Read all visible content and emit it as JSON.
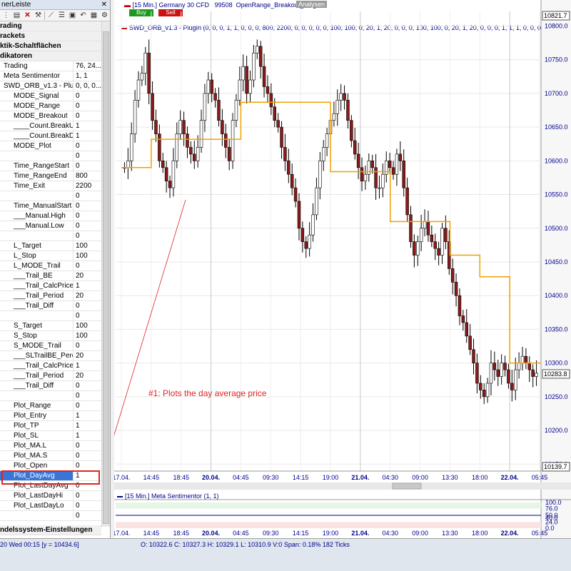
{
  "left_panel": {
    "title": "nerLeiste",
    "close": "✕",
    "toolbar_icons": [
      "grip-icon",
      "save-icon",
      "delete-icon",
      "tools-icon",
      "chart-icon",
      "list-icon",
      "view-icon",
      "undo-icon",
      "table-icon",
      "settings-icon"
    ],
    "categories": [
      "rading",
      "rackets",
      "ktik-Schaltflächen",
      "dikatoren"
    ],
    "properties": [
      {
        "name": "Trading",
        "value": "76, 24...",
        "indent": false
      },
      {
        "name": "Meta Sentimentor",
        "value": "1, 1",
        "indent": false
      },
      {
        "name": "SWD_ORB_v1.3 - Plu...",
        "value": "0, 0, 0...",
        "indent": false
      },
      {
        "name": "MODE_Signal",
        "value": "0",
        "indent": true
      },
      {
        "name": "MODE_Range",
        "value": "0",
        "indent": true
      },
      {
        "name": "MODE_Breakout",
        "value": "0",
        "indent": true
      },
      {
        "name": "____Count.BreakUp",
        "value": "1",
        "indent": true
      },
      {
        "name": "____Count.BreakDn",
        "value": "1",
        "indent": true
      },
      {
        "name": "MODE_Plot",
        "value": "0",
        "indent": true
      },
      {
        "name": "",
        "value": "0",
        "indent": true
      },
      {
        "name": "Time_RangeStart",
        "value": "0",
        "indent": true
      },
      {
        "name": "Time_RangeEnd",
        "value": "800",
        "indent": true
      },
      {
        "name": "Time_Exit",
        "value": "2200",
        "indent": true
      },
      {
        "name": "",
        "value": "0",
        "indent": true
      },
      {
        "name": "Time_ManualStart",
        "value": "0",
        "indent": true
      },
      {
        "name": "___Manual.High",
        "value": "0",
        "indent": true
      },
      {
        "name": "___Manual.Low",
        "value": "0",
        "indent": true
      },
      {
        "name": "",
        "value": "0",
        "indent": true
      },
      {
        "name": "L_Target",
        "value": "100",
        "indent": true
      },
      {
        "name": "L_Stop",
        "value": "100",
        "indent": true
      },
      {
        "name": "L_MODE_Trail",
        "value": "0",
        "indent": true
      },
      {
        "name": "___Trail_BE",
        "value": "20",
        "indent": true
      },
      {
        "name": "___Trail_CalcPrice",
        "value": "1",
        "indent": true
      },
      {
        "name": "___Trail_Period",
        "value": "20",
        "indent": true
      },
      {
        "name": "___Trail_Diff",
        "value": "0",
        "indent": true
      },
      {
        "name": "",
        "value": "0",
        "indent": true
      },
      {
        "name": "S_Target",
        "value": "100",
        "indent": true
      },
      {
        "name": "S_Stop",
        "value": "100",
        "indent": true
      },
      {
        "name": "S_MODE_Trail",
        "value": "0",
        "indent": true
      },
      {
        "name": "___SLTrailBE_Perc",
        "value": "20",
        "indent": true
      },
      {
        "name": "___Trail_CalcPrice",
        "value": "1",
        "indent": true
      },
      {
        "name": "___Trail_Period",
        "value": "20",
        "indent": true
      },
      {
        "name": "___Trail_Diff",
        "value": "0",
        "indent": true
      },
      {
        "name": "",
        "value": "0",
        "indent": true
      },
      {
        "name": "Plot_Range",
        "value": "0",
        "indent": true
      },
      {
        "name": "Plot_Entry",
        "value": "1",
        "indent": true
      },
      {
        "name": "Plot_TP",
        "value": "1",
        "indent": true
      },
      {
        "name": "Plot_SL",
        "value": "1",
        "indent": true
      },
      {
        "name": "Plot_MA.L",
        "value": "0",
        "indent": true
      },
      {
        "name": "Plot_MA.S",
        "value": "0",
        "indent": true
      },
      {
        "name": "Plot_Open",
        "value": "0",
        "indent": true
      },
      {
        "name": "Plot_DayAvg",
        "value": "1",
        "indent": true,
        "selected": true
      },
      {
        "name": "Plot_LastDayAvg",
        "value": "0",
        "indent": true
      },
      {
        "name": "Plot_LastDayHi",
        "value": "0",
        "indent": true
      },
      {
        "name": "Plot_LastDayLo",
        "value": "0",
        "indent": true
      },
      {
        "name": "",
        "value": "0",
        "indent": true
      }
    ],
    "footer_category": "ndelssystem-Einstellungen"
  },
  "chart_header": {
    "title": "[15 Min.] Germany 30 CFD",
    "id": "99508",
    "strategy": "OpenRange_Breakout_PlugIn",
    "analysen": "Analysen",
    "buy": "Buy",
    "sell": "Sell",
    "indicator_line": "SWD_ORB_v1.3 - PlugIn  (0, 0, 0, 1, 1, 0, 0, 0, 800, 2200, 0, 0, 0, 0, 0, 100, 100, 0, 20, 1, 20, 0, 0, 0, 100, 100, 0, 20, 1, 20, 0, 0, 0, 1, 1, 1, 0, 0, 0, 1, 0,"
  },
  "annotation": "#1: Plots the day average price",
  "sub_panel": {
    "title": "[15 Min.] Meta Sentimentor  (1, 1)"
  },
  "status_bar": {
    "left": "20 Wed  00:15 [y = 10434.6]",
    "right": "O: 10322.6 C: 10327.3 H: 10329.1 L: 10310.9 V:0 Span: 0.18% 182 Ticks"
  },
  "colors": {
    "bull": "#ffffff",
    "bear": "#8b1a1a",
    "wick": "#000000",
    "day_avg": "#f0a000",
    "axis_text": "#00008b"
  },
  "chart_data": {
    "type": "candlestick",
    "title": "[15 Min.] Germany 30 CFD",
    "y_axis_ticks": [
      10800,
      10750,
      10700,
      10650,
      10600,
      10550,
      10500,
      10450,
      10400,
      10350,
      10300,
      10250,
      10200,
      10150
    ],
    "ylim": [
      10139.7,
      10821.7
    ],
    "y_labels_boxed": [
      "10821.7",
      "10283.8",
      "10139.7"
    ],
    "x_tick_labels": [
      "17.04.",
      "14:45",
      "18:45",
      "20.04.",
      "04:45",
      "09:30",
      "14:15",
      "19:00",
      "21.04.",
      "04:30",
      "09:00",
      "13:30",
      "18:00",
      "22.04.",
      "05:45"
    ],
    "x_tick_bold": [
      false,
      false,
      false,
      true,
      false,
      false,
      false,
      false,
      true,
      false,
      false,
      false,
      false,
      true,
      false
    ],
    "close_series": [
      10590,
      10600,
      10640,
      10690,
      10720,
      10730,
      10760,
      10700,
      10660,
      10640,
      10600,
      10590,
      10570,
      10560,
      10600,
      10640,
      10660,
      10640,
      10620,
      10610,
      10600,
      10620,
      10660,
      10700,
      10720,
      10700,
      10690,
      10660,
      10640,
      10620,
      10600,
      10660,
      10690,
      10720,
      10740,
      10700,
      10720,
      10760,
      10770,
      10740,
      10710,
      10700,
      10680,
      10660,
      10650,
      10620,
      10600,
      10580,
      10560,
      10540,
      10500,
      10480,
      10470,
      10490,
      10520,
      10560,
      10600,
      10620,
      10640,
      10660,
      10670,
      10690,
      10700,
      10690,
      10660,
      10630,
      10610,
      10590,
      10570,
      10580,
      10600,
      10590,
      10560,
      10560,
      10580,
      10600,
      10590,
      10580,
      10610,
      10600,
      10560,
      10520,
      10480,
      10460,
      10480,
      10500,
      10510,
      10490,
      10480,
      10470,
      10460,
      10500,
      10480,
      10440,
      10420,
      10400,
      10370,
      10360,
      10340,
      10320,
      10300,
      10270,
      10260,
      10250,
      10270,
      10300,
      10290,
      10280,
      10300,
      10290,
      10270,
      10260,
      10290,
      10300,
      10310,
      10300,
      10290,
      10280,
      10285
    ],
    "day_avg_steps": [
      {
        "from": "17.04.",
        "value": 10590
      },
      {
        "from": "14:45",
        "value": 10632
      },
      {
        "from": "04:45",
        "value": 10687
      },
      {
        "from": "19:00",
        "value": 10584
      },
      {
        "from": "04:30",
        "value": 10510
      },
      {
        "from": "13:30",
        "value": 10460
      },
      {
        "from": "18:00",
        "value": 10428
      },
      {
        "from": "22.04.",
        "value": 10300
      }
    ],
    "sub_y_ticks": [
      100.0,
      76.0,
      50.0,
      40.0,
      24.0,
      0.0
    ],
    "sub_current_value": 50.0
  }
}
